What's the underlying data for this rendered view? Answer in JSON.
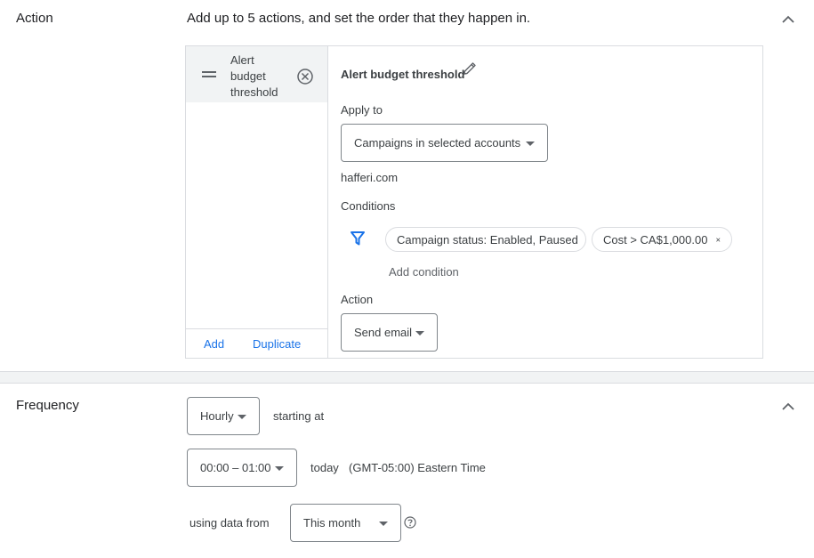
{
  "action_section": {
    "title": "Action",
    "description": "Add up to 5 actions, and set the order that they happen in.",
    "list_item": {
      "label_line1": "Alert",
      "label_line2": "budget",
      "label_line3": "threshold"
    },
    "add_label": "Add",
    "duplicate_label": "Duplicate",
    "detail": {
      "name": "Alert budget threshold",
      "apply_to_label": "Apply to",
      "apply_to_value": "Campaigns in selected accounts",
      "account": "hafferi.com",
      "conditions_label": "Conditions",
      "condition_chips": [
        "Campaign status: Enabled, Paused",
        "Cost > CA$1,000.00"
      ],
      "add_condition": "Add condition",
      "action_label": "Action",
      "action_value": "Send email"
    }
  },
  "frequency_section": {
    "title": "Frequency",
    "frequency_value": "Hourly",
    "starting_at": "starting at",
    "time_value": "00:00 – 01:00",
    "today": "today",
    "timezone": "(GMT-05:00) Eastern Time",
    "using_data_from": "using data from",
    "range_value": "This month"
  },
  "colors": {
    "accent": "#1a73e8",
    "border": "#dadce0",
    "divider_band": "#f1f3f4",
    "selected_bg": "#f1f3f4"
  }
}
